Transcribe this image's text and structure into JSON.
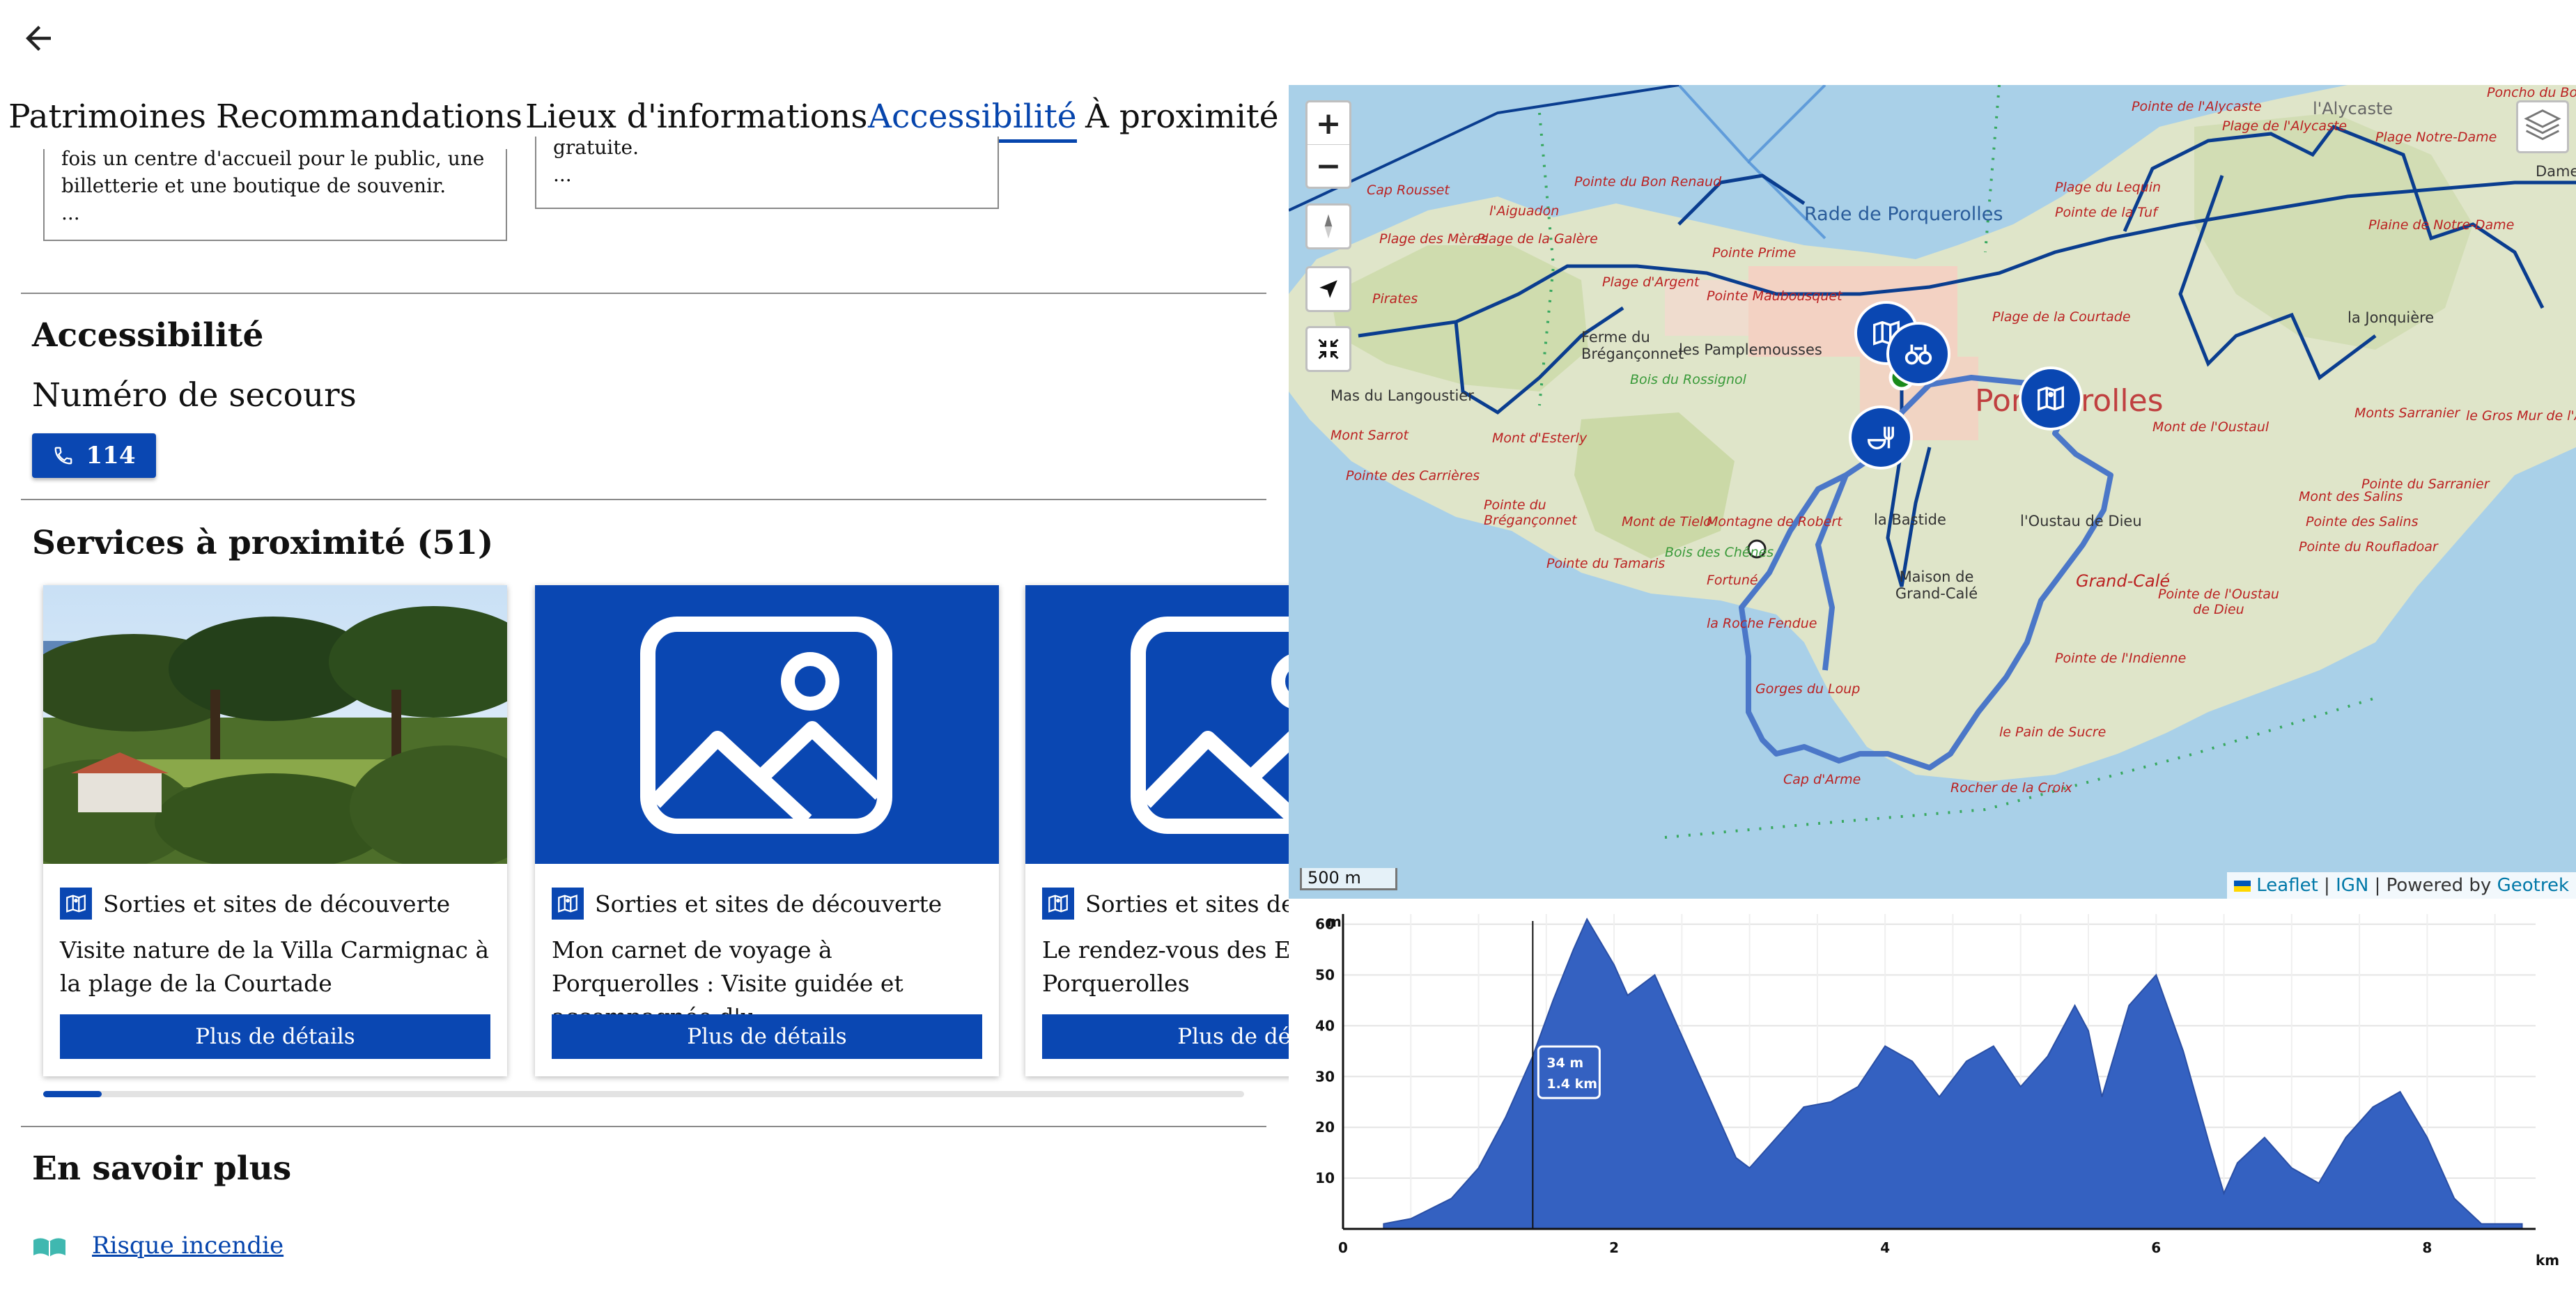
{
  "tabs": [
    {
      "label": "Patrimoines",
      "active": false
    },
    {
      "label": "Recommandations",
      "active": false
    },
    {
      "label": "Lieux d'informations",
      "active": false
    },
    {
      "label": "Accessibilité",
      "active": true
    },
    {
      "label": "À proximité",
      "active": false
    }
  ],
  "top_cards": [
    {
      "lines": [
        "fois un centre d'accueil pour le public, une",
        "billetterie et une boutique de souvenir.",
        "..."
      ]
    },
    {
      "lines": [
        "gratuite.",
        "..."
      ]
    }
  ],
  "accessibility": {
    "title": "Accessibilité",
    "emergency_label": "Numéro de secours",
    "emergency_number": "114"
  },
  "services": {
    "title": "Services à proximité (51)",
    "cards": [
      {
        "category": "Sorties et sites de découverte",
        "title": "Visite nature de la Villa Carmignac à la plage de la Courtade",
        "button": "Plus de détails",
        "image": "photo"
      },
      {
        "category": "Sorties et sites de découverte",
        "title": "Mon carnet de voyage à Porquerolles : Visite guidée et accompagnée d'u…",
        "button": "Plus de détails",
        "image": "placeholder"
      },
      {
        "category": "Sorties et sites de découverte",
        "title": "Le rendez-vous des Ep… Porquerolles",
        "button": "Plus de détails",
        "image": "placeholder"
      }
    ],
    "scroll_position": 0.05
  },
  "learn_more": {
    "title": "En savoir plus",
    "links": [
      {
        "label": "Risque incendie",
        "icon": "book-icon"
      }
    ]
  },
  "map": {
    "zoom_in": "+",
    "zoom_out": "−",
    "scale_label": "500 m",
    "attribution": {
      "leaflet": "Leaflet",
      "sep1": " | ",
      "ign": "IGN",
      "sep2": " | Powered by ",
      "geotrek": "Geotrek"
    },
    "labels": {
      "alycaste": "l'Alycaste",
      "pointe_alycaste": "Pointe de l'Alycaste",
      "plage_alycaste": "Plage de l'Alycaste",
      "poncho": "Poncho du Bou",
      "plage_notre_dame": "Plage Notre-Dame",
      "dame": "Dame",
      "plaine_notre_dame": "Plaine de Notre-Dame",
      "cap_rousset": "Cap Rousset",
      "aiguadon": "l'Aiguadon",
      "pointe_bon_renaud": "Pointe du Bon Renaud",
      "plage_lequin": "Plage du Lequin",
      "pointe_tuf": "Pointe de la Tuf",
      "plage_meres": "Plage des Mères",
      "plage_galere": "Plage de la Galère",
      "rade": "Rade de Porquerolles",
      "pointe_prime": "Pointe Prime",
      "plage_argent": "Plage d'Argent",
      "pointe_maubousquet": "Pointe Maubousquet",
      "plage_courtade": "Plage de la Courtade",
      "jonquiere": "la Jonquière",
      "pirates": "Pirates",
      "ferme": "Ferme du Brégançonnet",
      "pamplemousses": "les Pamplemousses",
      "bois_rossignol": "Bois du Rossignol",
      "porquerolles": "Porquerolles",
      "mas": "Mas du Langoustier",
      "mont_sarrot": "Mont Sarrot",
      "esterly": "Mont d'Esterly",
      "mont_oustaul": "Mont de l'Oustaul",
      "monts_sarranier": "Monts Sarranier",
      "gros_mur": "le Gros Mur de l'Alycaste",
      "pointe_carrieres": "Pointe des Carrières",
      "pointe_sarranier": "Pointe du Sarranier",
      "pointe_breganconnet": "Pointe du Brégançonnet",
      "mont_tielo": "Mont de Tielo",
      "montagne_robert": "Montagne de Robert",
      "bastide": "la Bastide",
      "oustau": "l'Oustau de Dieu",
      "mont_salins": "Mont des Salins",
      "pointe_salins": "Pointe des Salins",
      "pointe_roufladoar": "Pointe du Roufladoar",
      "pointe_tamaris": "Pointe du Tamaris",
      "bois_chenes": "Bois des Chênes",
      "fortune": "Fortuné",
      "maison_grand_cale": "Maison de Grand-Calé",
      "grand_cale": "Grand-Calé",
      "pointe_oustau": "Pointe de l'Oustau de Dieu",
      "roche_fendue": "la Roche Fendue",
      "indienne": "Pointe de l'Indienne",
      "gorges": "Gorges du Loup",
      "pain_sucre": "le Pain de Sucre",
      "cap_arme": "Cap d'Arme",
      "rocher_croix": "Rocher de la Croix"
    },
    "markers": [
      "map-icon",
      "binoculars-icon",
      "restaurant-icon",
      "map-icon"
    ]
  },
  "chart_data": {
    "type": "area",
    "xlabel": "km",
    "ylabel": "m",
    "xlim": [
      0,
      8.8
    ],
    "ylim": [
      0,
      62
    ],
    "x_ticks": [
      0,
      2,
      4,
      6,
      8
    ],
    "y_ticks": [
      10,
      20,
      30,
      40,
      50,
      60
    ],
    "grid": true,
    "series": [
      {
        "x": [
          0.3,
          0.5,
          0.8,
          1.0,
          1.2,
          1.4,
          1.55,
          1.7,
          1.8,
          2.0,
          2.1,
          2.3,
          2.5,
          2.7,
          2.9,
          3.0,
          3.2,
          3.4,
          3.6,
          3.8,
          4.0,
          4.2,
          4.4,
          4.6,
          4.8,
          5.0,
          5.2,
          5.4,
          5.5,
          5.6,
          5.8,
          6.0,
          6.2,
          6.4,
          6.5,
          6.6,
          6.8,
          7.0,
          7.2,
          7.4,
          7.6,
          7.8,
          8.0,
          8.2,
          8.4,
          8.6,
          8.7
        ],
        "y": [
          1,
          2,
          6,
          12,
          22,
          34,
          45,
          55,
          61,
          52,
          46,
          50,
          38,
          26,
          14,
          12,
          18,
          24,
          25,
          28,
          36,
          33,
          26,
          33,
          36,
          28,
          34,
          44,
          39,
          26,
          44,
          50,
          35,
          16,
          7,
          13,
          18,
          12,
          9,
          18,
          24,
          27,
          18,
          6,
          1,
          1,
          1
        ]
      }
    ],
    "cursor": {
      "x": 1.4,
      "y": 34,
      "label_y": "34 m",
      "label_x": "1.4 km"
    }
  }
}
